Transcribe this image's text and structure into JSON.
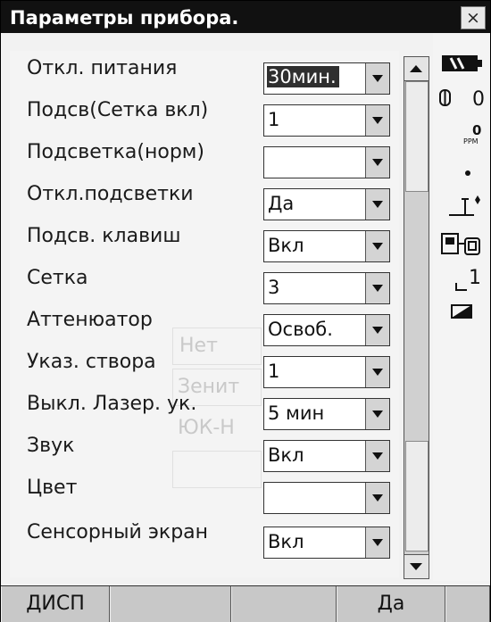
{
  "window": {
    "title": "Параметры прибора.",
    "close_label": "×"
  },
  "settings": [
    {
      "label": "Откл. питания",
      "value": "30мин.",
      "selected": true
    },
    {
      "label": "Подсв(Сетка вкл)",
      "value": "1"
    },
    {
      "label": "Подсветка(норм)",
      "value": ""
    },
    {
      "label": "Откл.подсветки",
      "value": "Да"
    },
    {
      "label": "Подсв. клавиш",
      "value": "Вкл"
    },
    {
      "label": "Сетка",
      "value": "3"
    },
    {
      "label": "Аттенюатор",
      "value": "Освоб."
    },
    {
      "label": "Указ. створа",
      "value": "1"
    },
    {
      "label": "Выкл. Лазер. ук.",
      "value": "5 мин"
    },
    {
      "label": "Звук",
      "value": "Вкл"
    },
    {
      "label": "Цвет",
      "value": ""
    },
    {
      "label": "Сенсорный экран",
      "value": "Вкл"
    }
  ],
  "ghost_text": [
    "Нет",
    "Зенит",
    "ЮК-Н"
  ],
  "status": {
    "prism_constant": "0",
    "ppm_value": "0",
    "ppm_label": "PPM",
    "level_value": "1",
    "icons": [
      "battery-icon",
      "prism-icon",
      "ppm-icon",
      "dot-icon",
      "tilt-icon",
      "instrument-icon",
      "level-icon",
      "pen-icon"
    ]
  },
  "softkeys": [
    "ДИСП",
    "",
    "",
    "Да",
    ""
  ]
}
